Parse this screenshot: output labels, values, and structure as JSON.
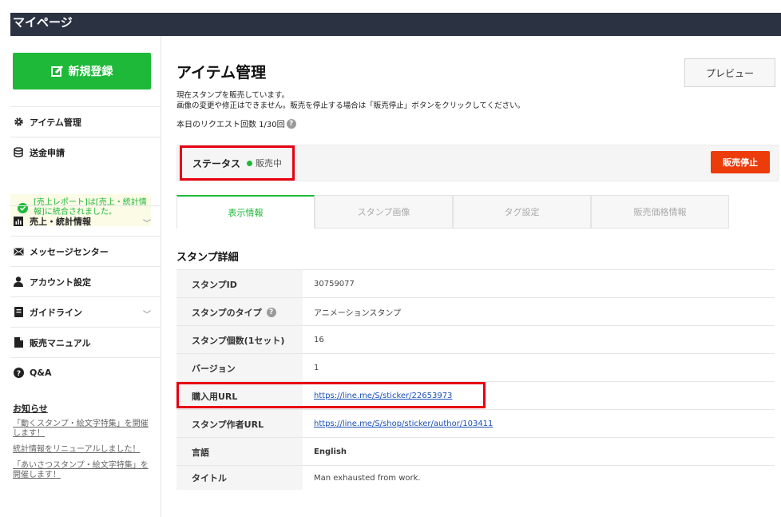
{
  "topbar": {
    "title": "マイページ"
  },
  "sidebar": {
    "new_button": "新規登録",
    "items": [
      {
        "label": "アイテム管理",
        "icon": "gear-icon"
      },
      {
        "label": "送金申請",
        "icon": "database-icon"
      },
      {
        "label": "売上・統計情報",
        "icon": "bar-chart-icon"
      },
      {
        "label": "メッセージセンター",
        "icon": "mail-icon"
      },
      {
        "label": "アカウント設定",
        "icon": "user-icon"
      },
      {
        "label": "ガイドライン",
        "icon": "book-icon"
      },
      {
        "label": "販売マニュアル",
        "icon": "document-icon"
      },
      {
        "label": "Q&A",
        "icon": "question-icon"
      }
    ],
    "notice": "[売上レポート]は[売上・統計情報]に統合されました。",
    "news_heading": "お知らせ",
    "news": [
      "「動くスタンプ・絵文字特集」を開催します！",
      "統計情報をリニューアルしました！",
      "「あいさつスタンプ・絵文字特集」を開催します！"
    ]
  },
  "main": {
    "title": "アイテム管理",
    "preview_button": "プレビュー",
    "desc1": "現在スタンプを販売しています。",
    "desc2": "画像の変更や修正はできません。販売を停止する場合は「販売停止」ボタンをクリックしてください。",
    "request_count": "本日のリクエスト回数 1/30回",
    "status_label": "ステータス",
    "status_value": "販売中",
    "stop_button": "販売停止",
    "tabs": [
      "表示情報",
      "スタンプ画像",
      "タグ設定",
      "販売価格情報"
    ],
    "section_title": "スタンプ詳細",
    "rows": [
      {
        "key": "スタンプID",
        "value": "30759077"
      },
      {
        "key": "スタンプのタイプ",
        "value": "アニメーションスタンプ"
      },
      {
        "key": "スタンプ個数(1セット)",
        "value": "16"
      },
      {
        "key": "バージョン",
        "value": "1"
      },
      {
        "key": "購入用URL",
        "value": "https://line.me/S/sticker/22653973"
      },
      {
        "key": "スタンプ作者URL",
        "value": "https://line.me/S/shop/sticker/author/103411"
      },
      {
        "key": "言語",
        "value": "English"
      },
      {
        "key": "タイトル",
        "value": "Man exhausted from work."
      }
    ]
  },
  "colors": {
    "brand_green": "#1fb93a",
    "stop_red": "#ec3c0b",
    "highlight_red": "#e60012",
    "topbar": "#2b3242"
  }
}
